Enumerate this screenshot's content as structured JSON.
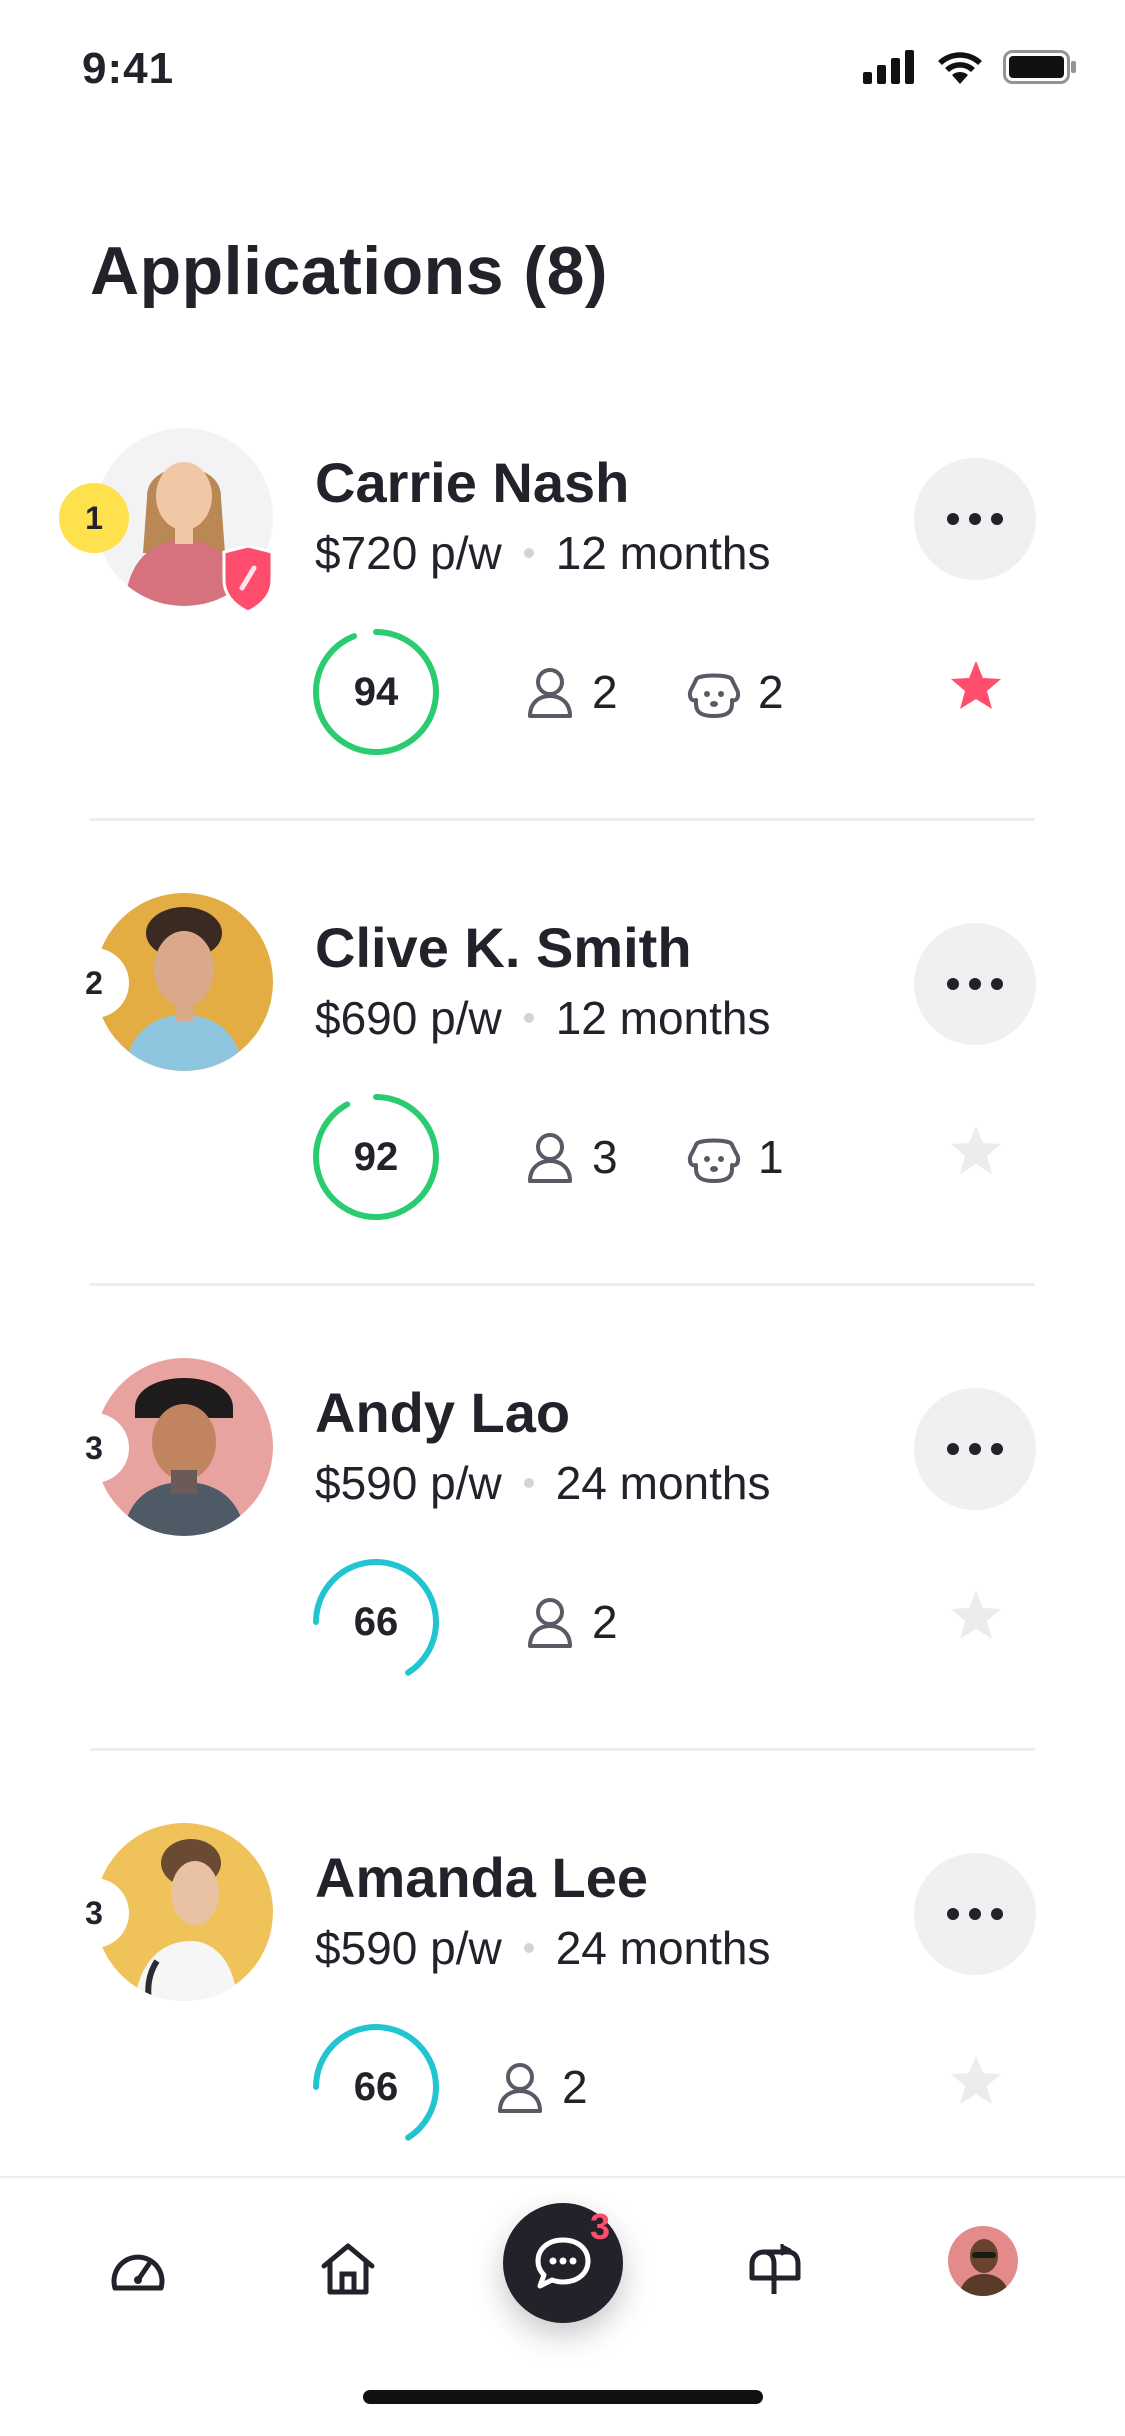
{
  "status_bar": {
    "time": "9:41"
  },
  "header": {
    "title": "Applications (8)"
  },
  "colors": {
    "score_green": "#2bcb6f",
    "score_teal": "#21c4d0",
    "star_active": "#ff4d6d",
    "star_inactive": "#ececee",
    "rank_yellow": "#ffe14d"
  },
  "applications": [
    {
      "rank": "1",
      "name": "Carrie Nash",
      "rent": "$720 p/w",
      "term": "12 months",
      "score": "94",
      "score_fraction": 0.94,
      "people": "2",
      "pets": "2",
      "starred": true,
      "verified": true
    },
    {
      "rank": "2",
      "name": "Clive K. Smith",
      "rent": "$690 p/w",
      "term": "12 months",
      "score": "92",
      "score_fraction": 0.92,
      "people": "3",
      "pets": "1",
      "starred": false,
      "verified": false
    },
    {
      "rank": "3",
      "name": "Andy Lao",
      "rent": "$590 p/w",
      "term": "24 months",
      "score": "66",
      "score_fraction": 0.66,
      "people": "2",
      "starred": false,
      "verified": false
    },
    {
      "rank": "3",
      "name": "Amanda Lee",
      "rent": "$590 p/w",
      "term": "24 months",
      "score": "66",
      "score_fraction": 0.66,
      "people": "2",
      "starred": false,
      "verified": false
    }
  ],
  "bottom_nav": {
    "items": [
      "dashboard-icon",
      "home-icon",
      "chat-icon",
      "mailbox-icon",
      "profile-avatar"
    ],
    "chat_badge": "3"
  }
}
